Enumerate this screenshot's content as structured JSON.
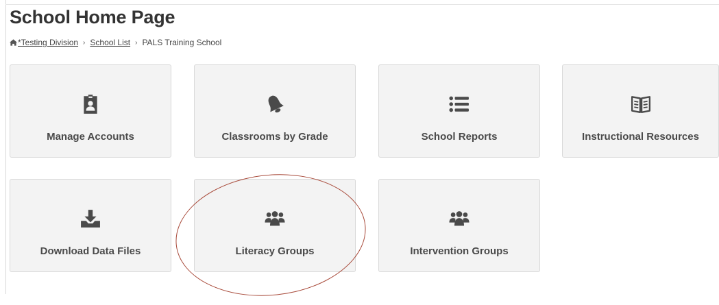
{
  "page": {
    "title": "School Home Page"
  },
  "breadcrumb": {
    "items": [
      {
        "label": "*Testing Division",
        "link": true
      },
      {
        "label": "School List",
        "link": true
      },
      {
        "label": "PALS Training School",
        "link": false
      }
    ],
    "separator": "›"
  },
  "tiles": [
    {
      "label": "Manage Accounts",
      "icon": "id-badge-icon"
    },
    {
      "label": "Classrooms by Grade",
      "icon": "bell-icon"
    },
    {
      "label": "School Reports",
      "icon": "list-icon"
    },
    {
      "label": "Instructional Resources",
      "icon": "open-book-icon"
    },
    {
      "label": "Download Data Files",
      "icon": "download-tray-icon"
    },
    {
      "label": "Literacy Groups",
      "icon": "users-group-icon"
    },
    {
      "label": "Intervention Groups",
      "icon": "users-group-icon"
    }
  ],
  "colors": {
    "tile_background": "#f3f3f3",
    "tile_border": "#d9d9d9",
    "text": "#4a4a4a",
    "annotation": "#a84a3a"
  }
}
